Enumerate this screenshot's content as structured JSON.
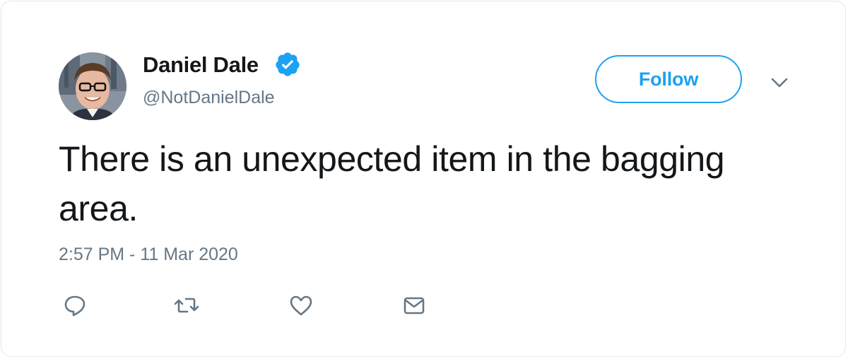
{
  "user": {
    "display_name": "Daniel Dale",
    "handle": "@NotDanielDale",
    "verified": true
  },
  "header": {
    "follow_label": "Follow",
    "caret_icon": "chevron-down-icon"
  },
  "tweet": {
    "text": "There is an unexpected item in the bagging area.",
    "timestamp": "2:57 PM - 11 Mar 2020"
  },
  "actions": [
    {
      "icon": "reply-icon"
    },
    {
      "icon": "retweet-icon"
    },
    {
      "icon": "like-icon"
    },
    {
      "icon": "direct-message-icon"
    }
  ],
  "colors": {
    "accent": "#1da1f2",
    "text_primary": "#14171a",
    "text_secondary": "#657786",
    "border": "#e1e8ed"
  }
}
